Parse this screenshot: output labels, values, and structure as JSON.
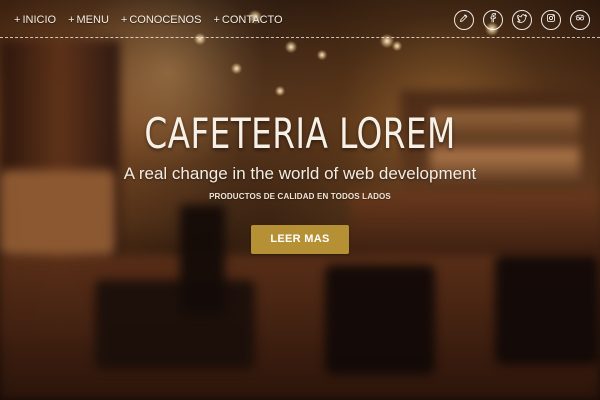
{
  "nav": {
    "items": [
      {
        "prefix": "+",
        "label": "INICIO"
      },
      {
        "prefix": "+",
        "label": "MENU"
      },
      {
        "prefix": "+",
        "label": "CONOCENOS"
      },
      {
        "prefix": "+",
        "label": "CONTACTO"
      }
    ],
    "social_icons": [
      "pencil-icon",
      "facebook-icon",
      "twitter-icon",
      "instagram-icon",
      "tripadvisor-icon"
    ]
  },
  "hero": {
    "title": "CAFETERIA LOREM",
    "subtitle": "A real change in the world of web development",
    "tagline": "PRODUCTOS DE CALIDAD EN TODOS LADOS",
    "cta_label": "LEER MAS"
  },
  "colors": {
    "cta_background": "#b69035",
    "text_primary": "#f7f0e6",
    "background_dark": "#241208"
  }
}
